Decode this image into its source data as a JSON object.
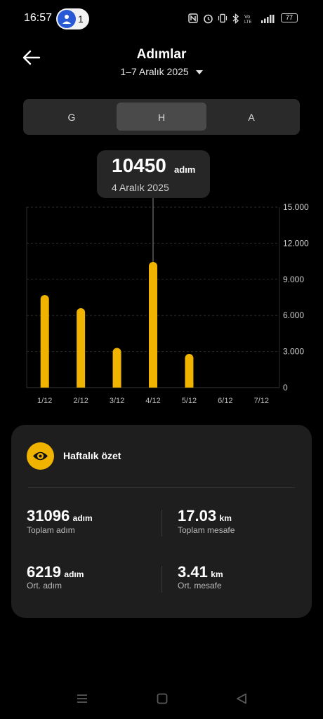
{
  "status_bar": {
    "time": "16:57",
    "hotspot_count": "1",
    "battery": "77"
  },
  "header": {
    "title": "Adımlar",
    "date_range": "1–7 Aralık 2025"
  },
  "segments": [
    "G",
    "H",
    "A"
  ],
  "selected_segment": "H",
  "tooltip": {
    "value": "10450",
    "unit": "adım",
    "date": "4 Aralık 2025"
  },
  "colors": {
    "bar": "#F0B400",
    "background": "#000000",
    "card": "#1E1E1E"
  },
  "chart_data": {
    "type": "bar",
    "categories": [
      "1/12",
      "2/12",
      "3/12",
      "4/12",
      "5/12",
      "6/12",
      "7/12"
    ],
    "values": [
      7700,
      6600,
      3300,
      10450,
      2800,
      0,
      0
    ],
    "ylim": [
      0,
      15000
    ],
    "yticks": [
      "15.000",
      "12.000",
      "9.000",
      "6.000",
      "3.000",
      "0"
    ],
    "grid": true,
    "highlighted_category": "4/12"
  },
  "summary": {
    "title": "Haftalık özet",
    "total_steps": {
      "value": "31096",
      "unit": "adım",
      "label": "Toplam adım"
    },
    "total_distance": {
      "value": "17.03",
      "unit": "km",
      "label": "Toplam mesafe"
    },
    "avg_steps": {
      "value": "6219",
      "unit": "adım",
      "label": "Ort. adım"
    },
    "avg_distance": {
      "value": "3.41",
      "unit": "km",
      "label": "Ort. mesafe"
    }
  },
  "icons": {
    "back": "arrow-left-icon",
    "dropdown": "triangle-down-icon",
    "summary": "eye-icon",
    "nav_menu": "menu-icon",
    "nav_home": "square-icon",
    "nav_back": "triangle-left-icon"
  }
}
